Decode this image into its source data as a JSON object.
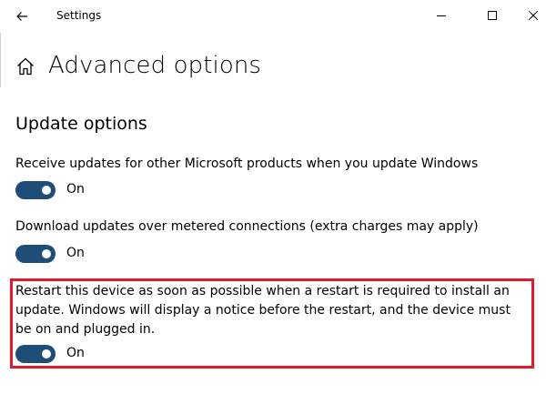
{
  "window": {
    "title": "Settings"
  },
  "page": {
    "title": "Advanced options",
    "section_title": "Update options"
  },
  "settings": [
    {
      "label": "Receive updates for other Microsoft products when you update Windows",
      "state": "On"
    },
    {
      "label": "Download updates over metered connections (extra charges may apply)",
      "state": "On"
    },
    {
      "label": "Restart this device as soon as possible when a restart is required to install an update. Windows will display a notice before the restart, and the device must be on and plugged in.",
      "state": "On"
    }
  ],
  "colors": {
    "toggle_on": "#1e4e78",
    "highlight": "#e21a2c"
  }
}
